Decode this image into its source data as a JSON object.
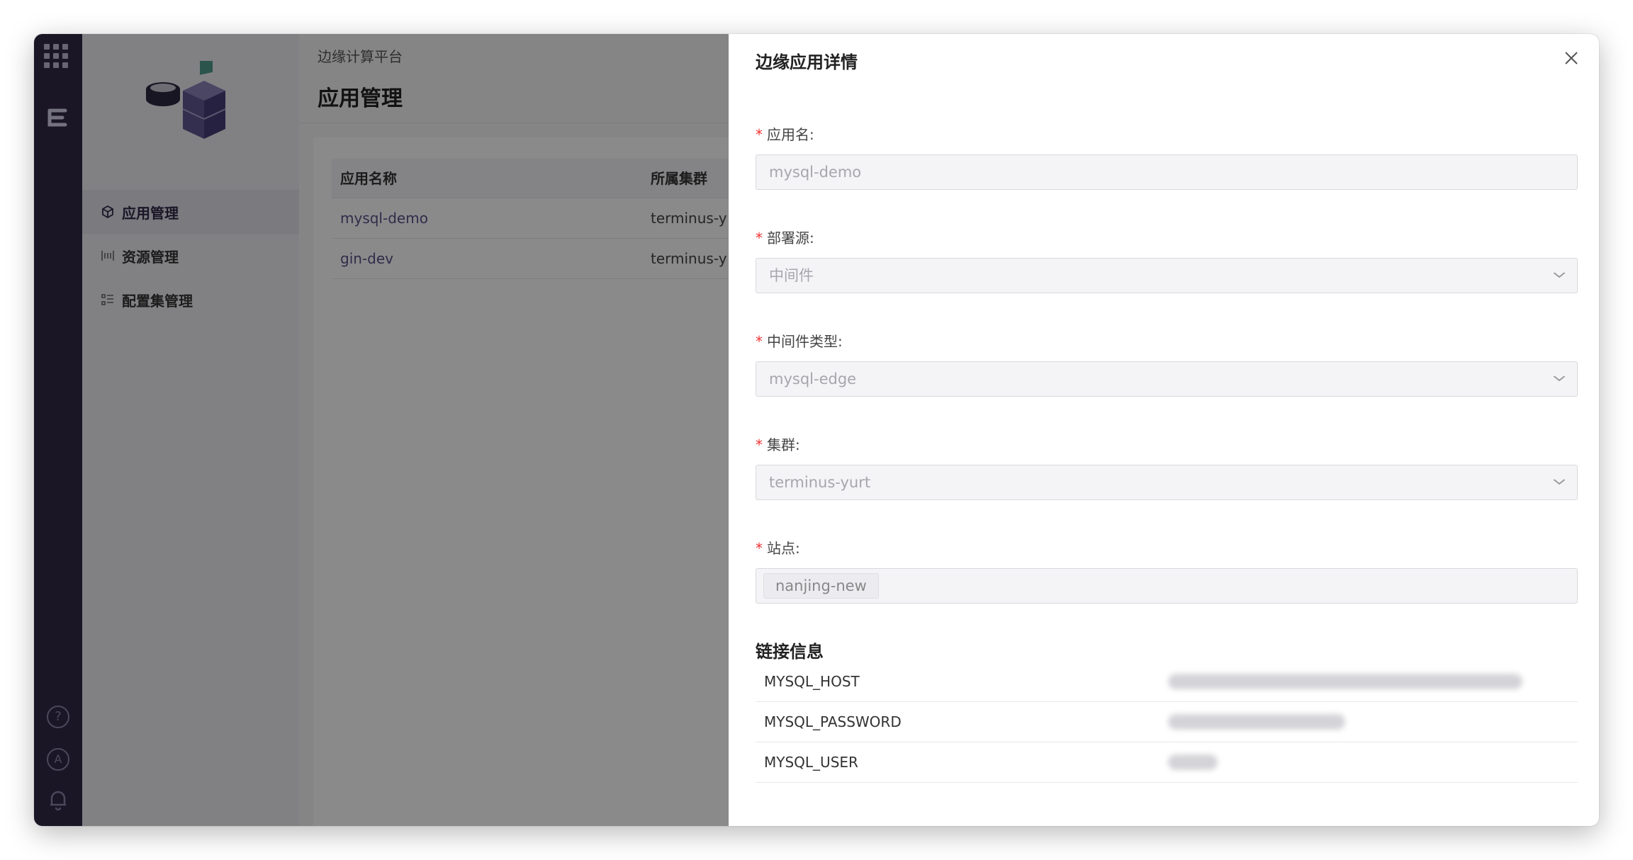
{
  "platform_breadcrumb": "边缘计算平台",
  "page_title": "应用管理",
  "sidebar": {
    "items": [
      {
        "label": "应用管理",
        "icon": "cube-icon",
        "active": true
      },
      {
        "label": "资源管理",
        "icon": "grid-bracket-icon",
        "active": false
      },
      {
        "label": "配置集管理",
        "icon": "list-icon",
        "active": false
      }
    ]
  },
  "table": {
    "columns": [
      "应用名称",
      "所属集群"
    ],
    "rows": [
      {
        "name": "mysql-demo",
        "cluster": "terminus-y"
      },
      {
        "name": "gin-dev",
        "cluster": "terminus-y"
      }
    ]
  },
  "drawer": {
    "title": "边缘应用详情",
    "fields": {
      "app_name": {
        "label": "应用名:",
        "value": "mysql-demo"
      },
      "deploy_source": {
        "label": "部署源:",
        "value": "中间件"
      },
      "middleware_type": {
        "label": "中间件类型:",
        "value": "mysql-edge"
      },
      "cluster": {
        "label": "集群:",
        "value": "terminus-yurt"
      },
      "site": {
        "label": "站点:",
        "tag": "nanjing-new"
      }
    },
    "required_mark": "*",
    "connection_title": "链接信息",
    "connection": [
      {
        "key": "MYSQL_HOST"
      },
      {
        "key": "MYSQL_PASSWORD"
      },
      {
        "key": "MYSQL_USER"
      }
    ]
  },
  "colors": {
    "rail": "#302846",
    "accent": "#5a4f86",
    "required": "#ee3333"
  }
}
